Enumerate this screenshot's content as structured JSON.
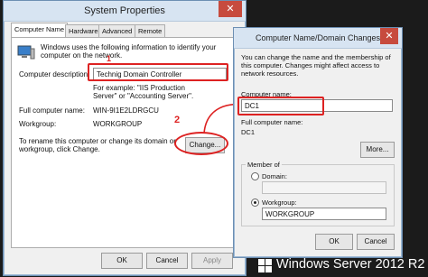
{
  "sys": {
    "title": "System Properties",
    "close": "✕",
    "tabs": [
      "Computer Name",
      "Hardware",
      "Advanced",
      "Remote"
    ],
    "intro": "Windows uses the following information to identify your computer on the network.",
    "desc_label": "Computer description:",
    "desc_value": "Technig Domain Controller",
    "example": "For example: \"IIS Production Server\" or \"Accounting Server\".",
    "fullname_label": "Full computer name:",
    "fullname_value": "WIN-9I1E2LDRGCU",
    "workgroup_label": "Workgroup:",
    "workgroup_value": "WORKGROUP",
    "rename_text": "To rename this computer or change its domain or workgroup, click Change.",
    "change_btn": "Change...",
    "ok_btn": "OK",
    "cancel_btn": "Cancel",
    "apply_btn": "Apply"
  },
  "cn": {
    "title": "Computer Name/Domain Changes",
    "close": "✕",
    "intro": "You can change the name and the membership of this computer. Changes might affect access to network resources.",
    "name_label": "Computer name:",
    "name_value": "DC1",
    "fullname_label": "Full computer name:",
    "fullname_value": "DC1",
    "more_btn": "More...",
    "member_label": "Member of",
    "domain_label": "Domain:",
    "workgroup_label": "Workgroup:",
    "workgroup_value": "WORKGROUP",
    "ok_btn": "OK",
    "cancel_btn": "Cancel"
  },
  "annotations": {
    "one": "1",
    "two": "2"
  },
  "watermark": "Windows Server 2012 R2"
}
